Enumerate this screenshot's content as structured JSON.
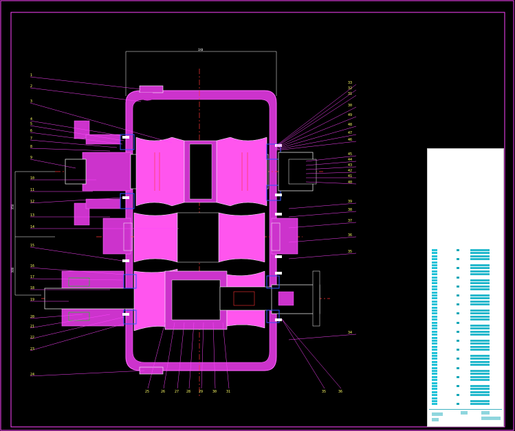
{
  "drawing": {
    "callouts_left": [
      "1",
      "2",
      "3",
      "4",
      "5",
      "6",
      "7",
      "8",
      "9",
      "10",
      "11",
      "12",
      "13",
      "14",
      "15",
      "16",
      "17",
      "18",
      "19",
      "20",
      "21",
      "22",
      "23",
      "24"
    ],
    "callouts_right": [
      "33",
      "32",
      "31",
      "30",
      "49",
      "48",
      "47",
      "46",
      "45",
      "44",
      "43",
      "42",
      "41",
      "40",
      "39",
      "38",
      "37",
      "36",
      "35",
      "34"
    ],
    "callouts_bottom": [
      "25",
      "26",
      "27",
      "28",
      "29",
      "30",
      "31",
      "35",
      "36"
    ],
    "dimension_labels": [
      "3X0",
      "X50",
      "X80"
    ],
    "colors": {
      "background": "#000000",
      "housing": "#cc33cc",
      "gear": "#ff55ee",
      "gear_cut": "#aa2299",
      "shaft": "#ffffff",
      "center_line": "#ff3333",
      "leader": "#ff44ff",
      "frame": "#ff44ff",
      "callout_text": "#ffff66",
      "bearing": "#3355ff",
      "hatch": "#22cc22"
    }
  },
  "title_block": {
    "colors": {
      "background": "#ffffff",
      "rows": "#1ec2d8",
      "grid": "#3bb0c0"
    }
  }
}
